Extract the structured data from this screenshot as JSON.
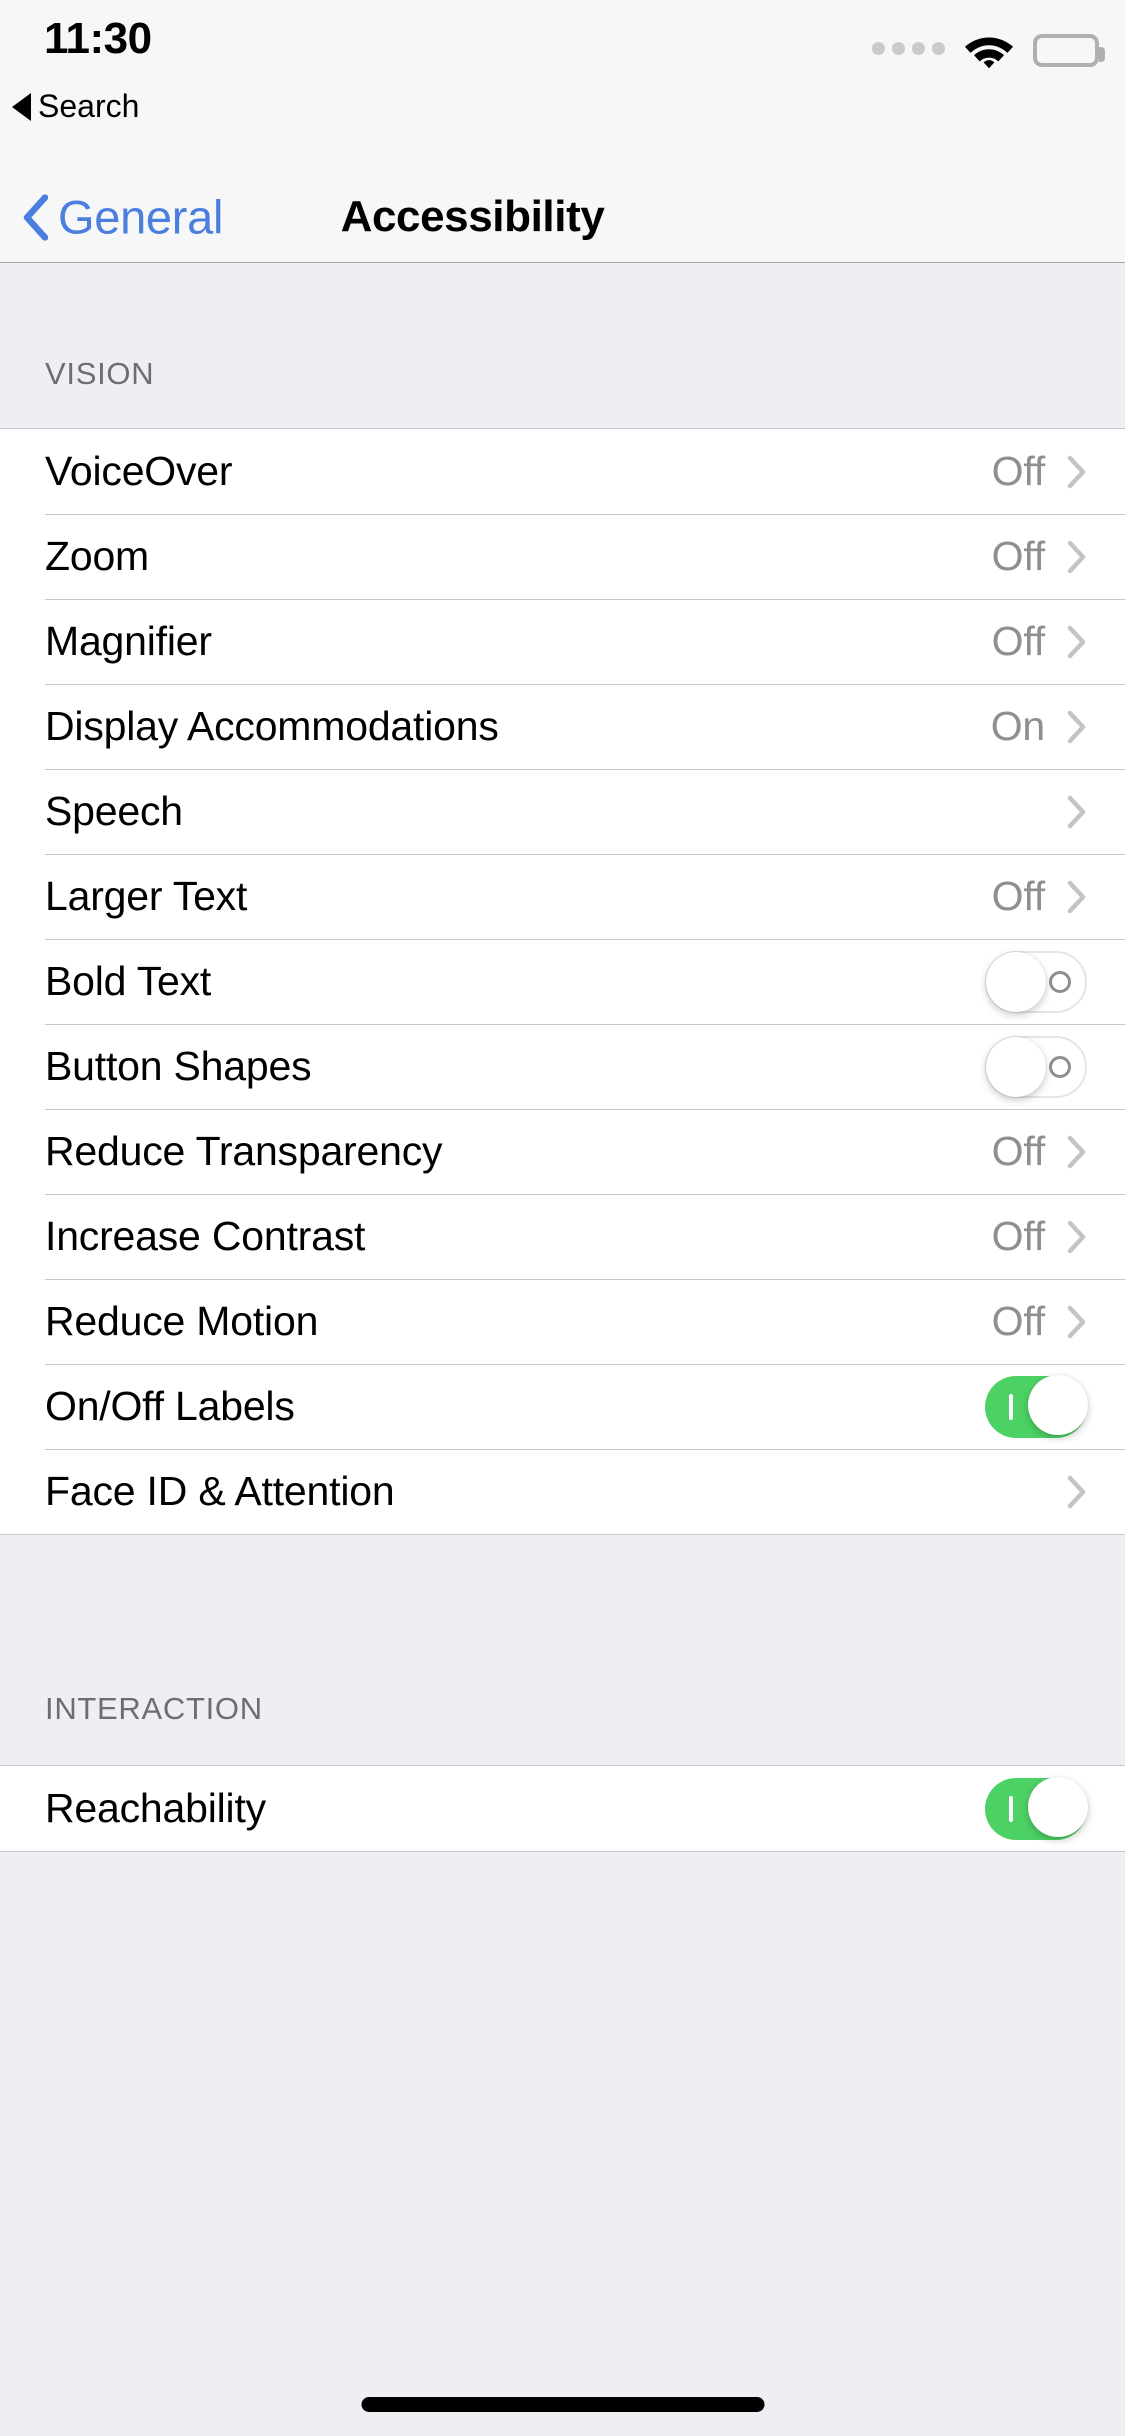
{
  "status_bar": {
    "time": "11:30",
    "back_app_label": "Search",
    "back_triangle_icon": "triangle-left-icon",
    "signal_dots_icon": "signal-dots-icon",
    "signal_dots_count": 4,
    "wifi_icon": "wifi-icon",
    "battery_icon": "battery-full-icon"
  },
  "nav_bar": {
    "back_label": "General",
    "back_chevron_icon": "chevron-left-icon",
    "title": "Accessibility"
  },
  "colors": {
    "accent_blue": "#4a7fe0",
    "switch_on_green": "#4cd264",
    "secondary_text": "#8e8e93",
    "section_header_text": "#6d6d72",
    "group_background": "#eeeef3",
    "separator": "#c8c7cc"
  },
  "sections": [
    {
      "header": "VISION",
      "rows": [
        {
          "label": "VoiceOver",
          "type": "disclosure",
          "value": "Off",
          "chevron_icon": "chevron-right-icon"
        },
        {
          "label": "Zoom",
          "type": "disclosure",
          "value": "Off",
          "chevron_icon": "chevron-right-icon"
        },
        {
          "label": "Magnifier",
          "type": "disclosure",
          "value": "Off",
          "chevron_icon": "chevron-right-icon"
        },
        {
          "label": "Display Accommodations",
          "type": "disclosure",
          "value": "On",
          "chevron_icon": "chevron-right-icon"
        },
        {
          "label": "Speech",
          "type": "disclosure",
          "value": "",
          "chevron_icon": "chevron-right-icon"
        },
        {
          "label": "Larger Text",
          "type": "disclosure",
          "value": "Off",
          "chevron_icon": "chevron-right-icon"
        },
        {
          "label": "Bold Text",
          "type": "switch",
          "state": "off",
          "switch_icon": "toggle-off-icon"
        },
        {
          "label": "Button Shapes",
          "type": "switch",
          "state": "off",
          "switch_icon": "toggle-off-icon"
        },
        {
          "label": "Reduce Transparency",
          "type": "disclosure",
          "value": "Off",
          "chevron_icon": "chevron-right-icon"
        },
        {
          "label": "Increase Contrast",
          "type": "disclosure",
          "value": "Off",
          "chevron_icon": "chevron-right-icon"
        },
        {
          "label": "Reduce Motion",
          "type": "disclosure",
          "value": "Off",
          "chevron_icon": "chevron-right-icon"
        },
        {
          "label": "On/Off Labels",
          "type": "switch",
          "state": "on",
          "switch_icon": "toggle-on-icon"
        },
        {
          "label": "Face ID & Attention",
          "type": "disclosure",
          "value": "",
          "chevron_icon": "chevron-right-icon"
        }
      ]
    },
    {
      "header": "INTERACTION",
      "rows": [
        {
          "label": "Reachability",
          "type": "switch",
          "state": "on",
          "switch_icon": "toggle-on-icon"
        }
      ]
    }
  ],
  "home_indicator": {
    "name": "home-indicator"
  }
}
